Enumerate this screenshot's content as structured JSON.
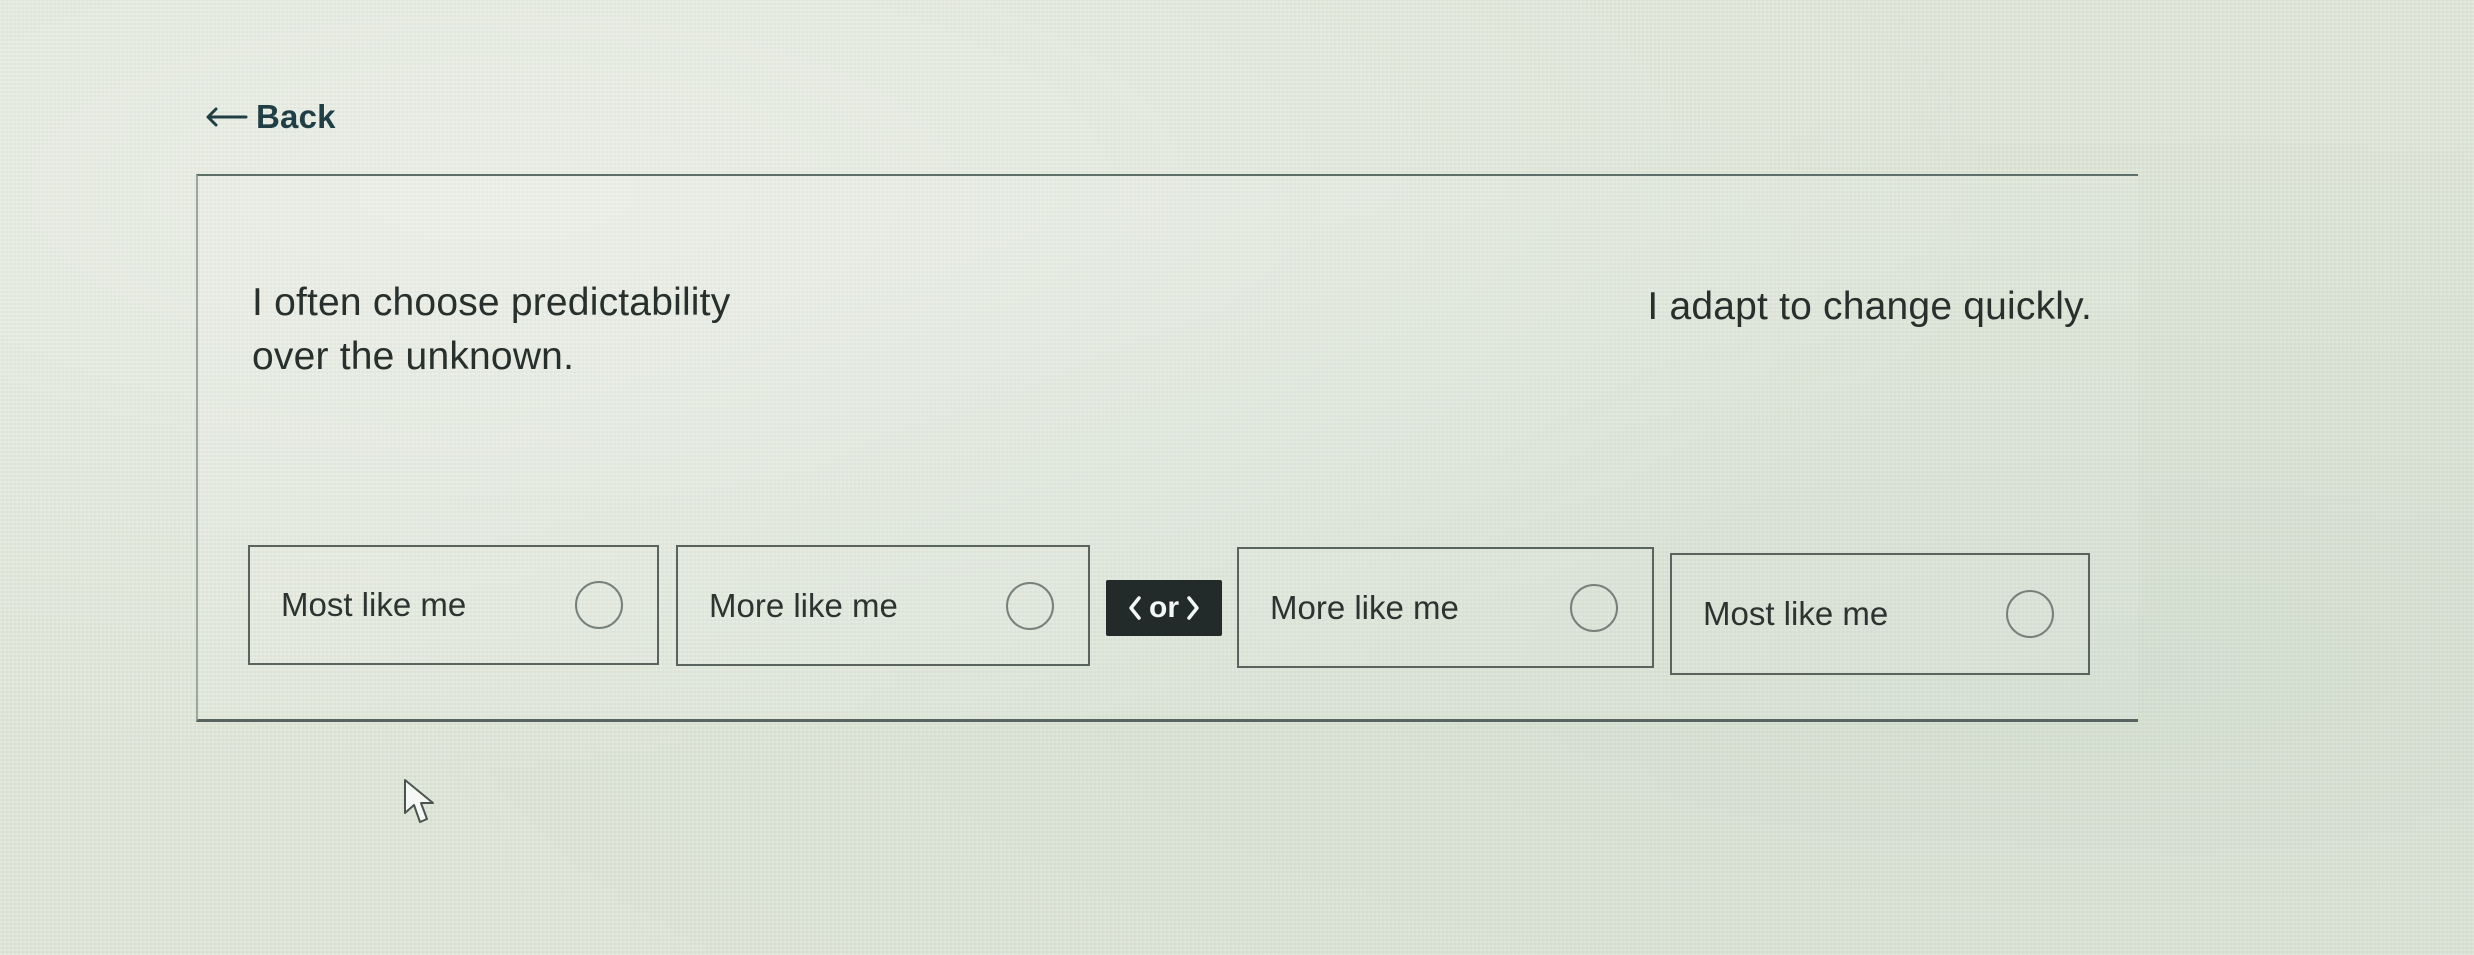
{
  "navigation": {
    "back_label": "Back"
  },
  "question": {
    "left_statement": "I often choose predictability over the unknown.",
    "right_statement": "I adapt to change quickly."
  },
  "connector": {
    "label": "or",
    "left_icon": "chevron-left-icon",
    "right_icon": "chevron-right-icon"
  },
  "options": [
    {
      "label": "Most like me",
      "side": "left",
      "selected": false
    },
    {
      "label": "More like me",
      "side": "left",
      "selected": false
    },
    {
      "label": "More like me",
      "side": "right",
      "selected": false
    },
    {
      "label": "Most like me",
      "side": "right",
      "selected": false
    }
  ],
  "colors": {
    "accent_text": "#1f3f45",
    "border": "#59645f",
    "or_background": "#232a2a",
    "or_text": "#f5f7f6"
  },
  "icons": {
    "back": "back-arrow-icon",
    "cursor": "mouse-pointer-icon"
  }
}
